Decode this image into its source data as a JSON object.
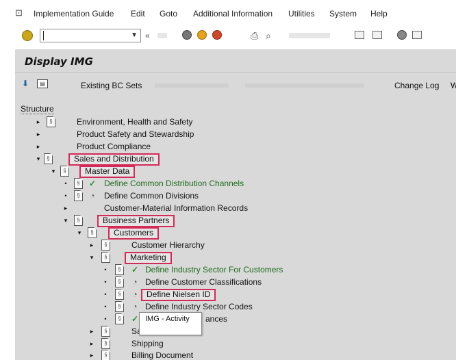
{
  "menu": {
    "items": [
      {
        "label": "Implementation Guide"
      },
      {
        "label": "Edit"
      },
      {
        "label": "Goto"
      },
      {
        "label": "Additional Information"
      },
      {
        "label": "Utilities"
      },
      {
        "label": "System"
      },
      {
        "label": "Help"
      }
    ]
  },
  "toolbar": {
    "command_value": "",
    "back_glyph": "«"
  },
  "title": "Display IMG",
  "app_toolbar": {
    "existing_bc_sets": "Existing BC Sets",
    "change_log": "Change Log",
    "overflow": "W"
  },
  "structure_label": "Structure",
  "tree": {
    "ehs": "Environment, Health and Safety",
    "pss": "Product Safety and Stewardship",
    "compliance": "Product Compliance",
    "sd": "Sales and Distribution",
    "master_data": "Master Data",
    "define_common_channels": "Define Common Distribution Channels",
    "define_common_divisions": "Define Common Divisions",
    "customer_material_info": "Customer-Material Information Records",
    "business_partners": "Business Partners",
    "customers": "Customers",
    "customer_hierarchy": "Customer Hierarchy",
    "marketing": "Marketing",
    "define_industry_sector": "Define Industry Sector For Customers",
    "define_customer_classifications": "Define Customer Classifications",
    "define_nielsen_id": "Define Nielsen ID",
    "define_industry_sector_codes": "Define Industry Sector Codes",
    "sales": "Sa",
    "shipping": "Shipping",
    "billing_document": "Billing Document"
  },
  "tooltip": "IMG - Activity",
  "tooltip_suffix": "ances",
  "colors": {
    "highlight": "#d42a5a",
    "panel": "#d9d9d9",
    "check": "#2a8a2a"
  }
}
